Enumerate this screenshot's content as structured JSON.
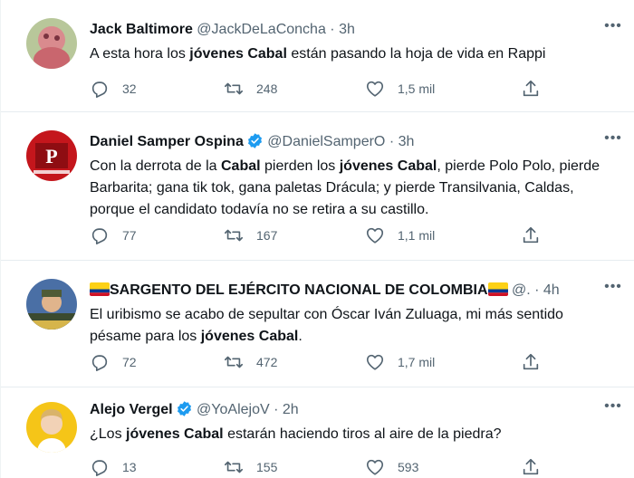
{
  "tweets": [
    {
      "name": "Jack Baltimore",
      "handle": "@JackDeLaConcha",
      "sep": "·",
      "time": "3h",
      "text": [
        {
          "t": "A esta hora los ",
          "b": false
        },
        {
          "t": "jóvenes Cabal",
          "b": true
        },
        {
          "t": " están pasando la hoja de vida en Rappi",
          "b": false
        }
      ],
      "replies": "32",
      "retweets": "248",
      "likes": "1,5 mil"
    },
    {
      "name": "Daniel Samper Ospina",
      "handle": "@DanielSamperO",
      "sep": "·",
      "time": "3h",
      "text": [
        {
          "t": "Con la derrota de la ",
          "b": false
        },
        {
          "t": "Cabal",
          "b": true
        },
        {
          "t": " pierden los ",
          "b": false
        },
        {
          "t": "jóvenes Cabal",
          "b": true
        },
        {
          "t": ", pierde Polo Polo, pierde Barbarita; gana tik tok, gana paletas Drácula; y pierde Transilvania, Caldas, porque el candidato todavía no se retira a su castillo.",
          "b": false
        }
      ],
      "replies": "77",
      "retweets": "167",
      "likes": "1,1 mil"
    },
    {
      "name": "SARGENTO DEL EJÉRCITO NACIONAL DE COLOMBIA",
      "handle": "@.",
      "sep": "·",
      "time": "4h",
      "text": [
        {
          "t": "El uribismo se acabo de sepultar con Óscar Iván Zuluaga, mi más sentido pésame para los ",
          "b": false
        },
        {
          "t": "jóvenes Cabal",
          "b": true
        },
        {
          "t": ".",
          "b": false
        }
      ],
      "replies": "72",
      "retweets": "472",
      "likes": "1,7 mil"
    },
    {
      "name": "Alejo Vergel",
      "handle": "@YoAlejoV",
      "sep": "·",
      "time": "2h",
      "text": [
        {
          "t": "¿Los ",
          "b": false
        },
        {
          "t": "jóvenes Cabal",
          "b": true
        },
        {
          "t": " estarán haciendo tiros al aire de la piedra?",
          "b": false
        }
      ],
      "replies": "13",
      "retweets": "155",
      "likes": "593"
    }
  ],
  "icons": {
    "reply": "reply-icon",
    "retweet": "retweet-icon",
    "like": "heart-icon",
    "share": "share-icon",
    "more": "more-icon",
    "verified": "verified-badge-icon",
    "flag": "colombia-flag-icon"
  },
  "colors": {
    "text": "#0f1419",
    "muted": "#536471",
    "verified": "#1d9bf0",
    "border": "#e6ecf0"
  }
}
